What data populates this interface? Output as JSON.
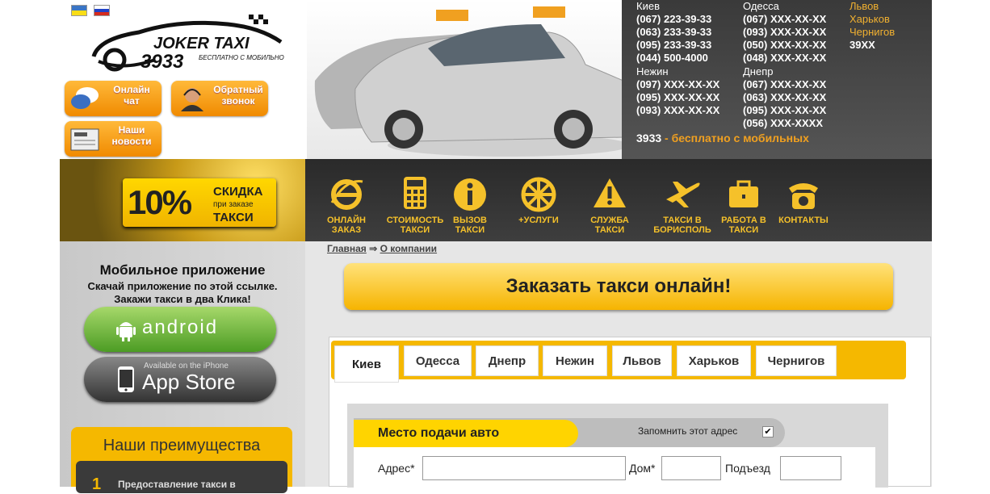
{
  "logo": {
    "brand": "JOKER TAXI",
    "number": "3933",
    "tagline": "БЕСПЛАТНО С МОБИЛЬНОГО"
  },
  "buttons": {
    "chat": "Онлайн чат",
    "callback": "Обратный звонок",
    "news": "Наши новости"
  },
  "phones": {
    "kiev": {
      "city": "Киев",
      "numbers": [
        "(067) 223-39-33",
        "(063) 233-39-33",
        "(095) 233-39-33",
        "(044) 500-4000"
      ]
    },
    "odessa": {
      "city": "Одесса",
      "numbers": [
        "(067) XXX-XX-XX",
        "(093) XXX-XX-XX",
        "(050) XXX-XX-XX",
        "(048) XXX-XX-XX"
      ]
    },
    "other": {
      "cities": [
        "Львов",
        "Харьков",
        "Чернигов"
      ],
      "code": "39XX"
    },
    "nezhin": {
      "city": "Нежин",
      "numbers": [
        "(097) XXX-XX-XX",
        "(095) XXX-XX-XX",
        "(093) XXX-XX-XX"
      ]
    },
    "dnepr": {
      "city": "Днепр",
      "numbers": [
        "(067) XXX-XX-XX",
        "(063) XXX-XX-XX",
        "(095) XXX-XX-XX",
        "(056) XXX-XXXX"
      ]
    },
    "free_code": "3933",
    "free_text": "- бесплатно с мобильных"
  },
  "promo": {
    "percent": "10%",
    "l1": "СКИДКА",
    "l2": "при заказе",
    "l3": "ТАКСИ"
  },
  "nav": [
    {
      "label1": "ОНЛАЙН",
      "label2": "ЗАКАЗ",
      "icon": "ie-icon"
    },
    {
      "label1": "СТОИМОСТЬ",
      "label2": "ТАКСИ",
      "icon": "calculator-icon"
    },
    {
      "label1": "ВЫЗОВ",
      "label2": "ТАКСИ",
      "icon": "info-icon"
    },
    {
      "label1": "+УСЛУГИ",
      "label2": "",
      "icon": "wheel-icon"
    },
    {
      "label1": "СЛУЖБА",
      "label2": "ТАКСИ",
      "icon": "warning-icon"
    },
    {
      "label1": "ТАКСИ В",
      "label2": "БОРИСПОЛЬ",
      "icon": "plane-icon"
    },
    {
      "label1": "РАБОТА В",
      "label2": "ТАКСИ",
      "icon": "briefcase-icon"
    },
    {
      "label1": "КОНТАКТЫ",
      "label2": "",
      "icon": "phone-icon"
    }
  ],
  "sidebar": {
    "title": "Мобильное приложение",
    "sub1": "Скачай приложение по этой ссылке.",
    "sub2": "Закажи такси в два Клика!",
    "android": "android",
    "appstore_small": "Available on the iPhone",
    "appstore": "App Store",
    "adv_title": "Наши преимущества",
    "adv_num": "1",
    "adv_first": "Предоставление такси в"
  },
  "breadcrumb": {
    "home": "Главная",
    "arrow": "⇒",
    "current": "О компании"
  },
  "order_button": "Заказать такси онлайн!",
  "tabs": [
    "Киев",
    "Одесса",
    "Днепр",
    "Нежин",
    "Львов",
    "Харьков",
    "Чернигов"
  ],
  "form": {
    "section": "Место подачи авто",
    "remember": "Запомнить этот адрес",
    "remember_checked": "✔",
    "address": "Адрес*",
    "house": "Дом*",
    "entrance": "Подъезд"
  }
}
